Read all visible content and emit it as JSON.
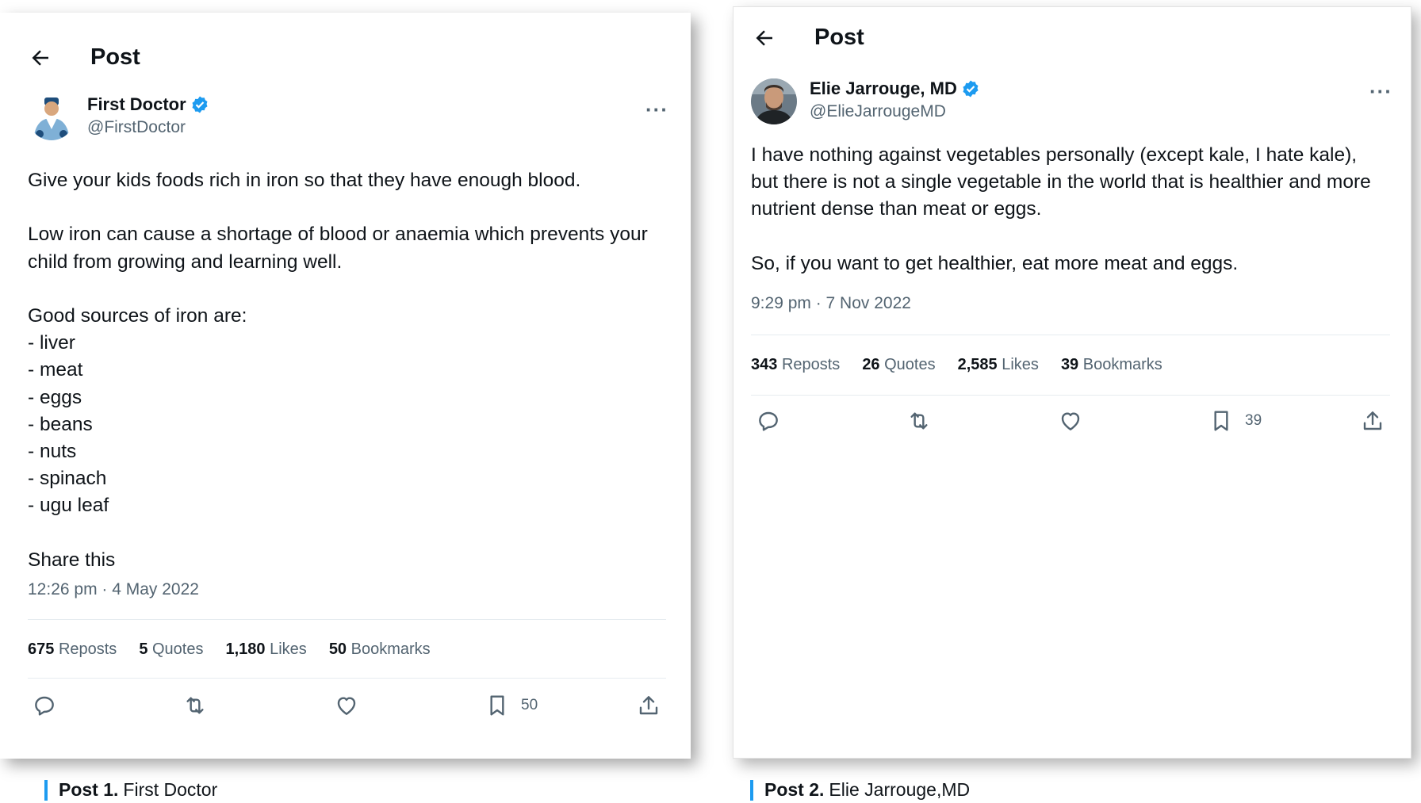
{
  "posts": [
    {
      "header_title": "Post",
      "author_name": "First Doctor",
      "handle": "@FirstDoctor",
      "paragraphs": [
        [
          "Give your kids foods rich in iron so that they have enough blood."
        ],
        [
          "Low iron can cause a shortage of blood or anaemia which prevents your",
          "child from growing and learning well."
        ],
        [
          "Good sources of iron are:",
          "- liver",
          "- meat",
          "- eggs",
          "- beans",
          "- nuts",
          "- spinach",
          "- ugu leaf"
        ],
        [
          "Share this"
        ]
      ],
      "timestamp": "12:26 pm · 4 May 2022",
      "stats": {
        "reposts_count": "675",
        "reposts_label": "Reposts",
        "quotes_count": "5",
        "quotes_label": "Quotes",
        "likes_count": "1,180",
        "likes_label": "Likes",
        "bookmarks_count": "50",
        "bookmarks_label": "Bookmarks"
      },
      "bookmark_action_count": "50"
    },
    {
      "header_title": "Post",
      "author_name": "Elie Jarrouge, MD",
      "handle": "@ElieJarrougeMD",
      "paragraphs": [
        [
          "I have nothing against vegetables personally (except kale, I hate kale),",
          "but there is not a single vegetable in the world that is healthier and more",
          "nutrient dense than meat or eggs."
        ],
        [
          "So, if you want to get healthier, eat more meat and eggs."
        ]
      ],
      "timestamp": "9:29 pm · 7 Nov 2022",
      "stats": {
        "reposts_count": "343",
        "reposts_label": "Reposts",
        "quotes_count": "26",
        "quotes_label": "Quotes",
        "likes_count": "2,585",
        "likes_label": "Likes",
        "bookmarks_count": "39",
        "bookmarks_label": "Bookmarks"
      },
      "bookmark_action_count": "39"
    }
  ],
  "captions": [
    {
      "bold": "Post 1.",
      "text": "First Doctor"
    },
    {
      "bold": "Post 2.",
      "text": "Elie Jarrouge,MD"
    }
  ],
  "colors": {
    "verified": "#1d9bf0",
    "caption_bar": "#1d9bf0",
    "secondary_text": "#536471"
  },
  "icons": [
    "back-arrow-icon",
    "verified-badge-icon",
    "more-options-icon",
    "reply-icon",
    "repost-icon",
    "like-icon",
    "bookmark-icon",
    "share-icon"
  ]
}
